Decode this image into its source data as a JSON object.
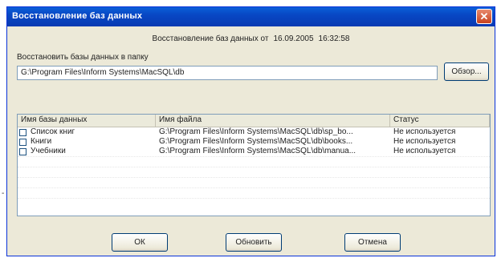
{
  "window": {
    "title": "Восстановление баз данных",
    "close_glyph": "✕"
  },
  "backup_info": {
    "label": "Восстановление баз данных от",
    "date": "16.09.2005",
    "time": "16:32:58"
  },
  "folder": {
    "label": "Восстановить базы данных в папку",
    "path": "G:\\Program Files\\Inform Systems\\MacSQL\\db",
    "browse_label": "Обзор..."
  },
  "table": {
    "columns": [
      "Имя базы данных",
      "Имя файла",
      "Статус"
    ],
    "rows": [
      {
        "name": "Список книг",
        "file": "G:\\Program Files\\Inform Systems\\MacSQL\\db\\sp_bo...",
        "status": "Не используется",
        "checked": false
      },
      {
        "name": "Книги",
        "file": "G:\\Program Files\\Inform Systems\\MacSQL\\db\\books...",
        "status": "Не используется",
        "checked": false
      },
      {
        "name": "Учебники",
        "file": "G:\\Program Files\\Inform Systems\\MacSQL\\db\\manua...",
        "status": "Не используется",
        "checked": false
      }
    ]
  },
  "buttons": {
    "ok": "ОК",
    "refresh": "Обновить",
    "cancel": "Отмена"
  },
  "stray_mark": "-"
}
